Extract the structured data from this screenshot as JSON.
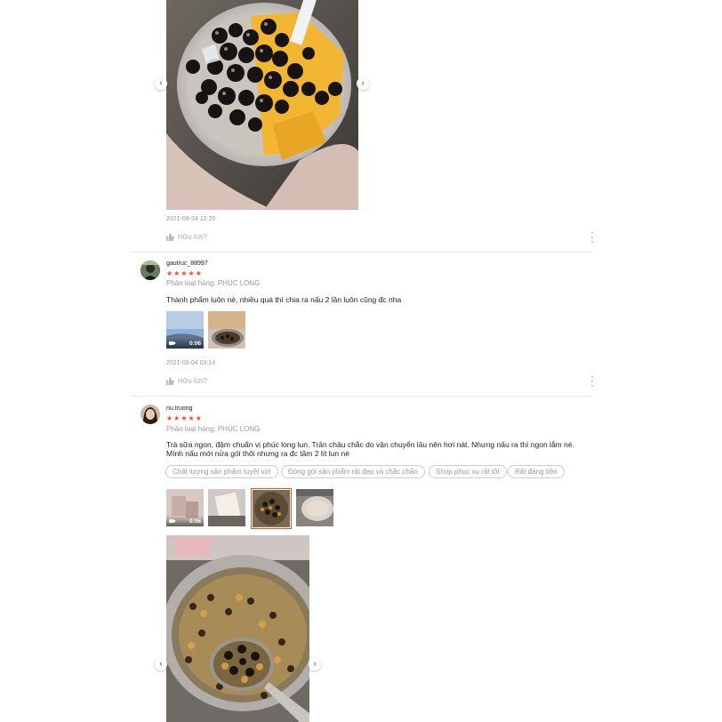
{
  "review1": {
    "timestamp": "2021-08-24 12:20",
    "helpful_label": "Hữu Ích?"
  },
  "review2": {
    "username": "gautruc_88997",
    "stars": "★★★★★",
    "variant": "Phân loại hàng: PHÚC LONG",
    "comment": "Thành phẩm luôn nè, nhiều quá thì chia ra nấu 2 lần luôn cũng đc nha",
    "video_duration": "0:06",
    "timestamp": "2021-08-04 03:14",
    "helpful_label": "Hữu Ích?"
  },
  "review3": {
    "username": "nu.truong",
    "stars": "★★★★★",
    "variant": "Phân loại hàng: PHÚC LONG",
    "comment": "Trà sữa ngon, đậm chuẩn vị phúc long lun. Trân châu chắc do vận chuyển lâu nên hơi nát. Nhưng nấu ra thì ngon lắm nè. Mình nấu mới nửa gói thôi nhưng ra đc tầm 2 lít lun nè",
    "tags": [
      "Chất lượng sản phẩm tuyệt vời",
      "Đóng gói sản phẩm rất đẹp và chắc chắn",
      "Shop phục vụ rất tốt",
      "Rất đáng tiền"
    ],
    "video_duration": "0:06"
  },
  "colors": {
    "star": "#ee4d2d",
    "selected_outline": "#ee4d2d"
  },
  "icons": {
    "prev": "chevron-left-icon",
    "next": "chevron-right-icon",
    "like": "thumbs-up-icon",
    "more": "more-vertical-icon",
    "video": "video-camera-icon"
  }
}
